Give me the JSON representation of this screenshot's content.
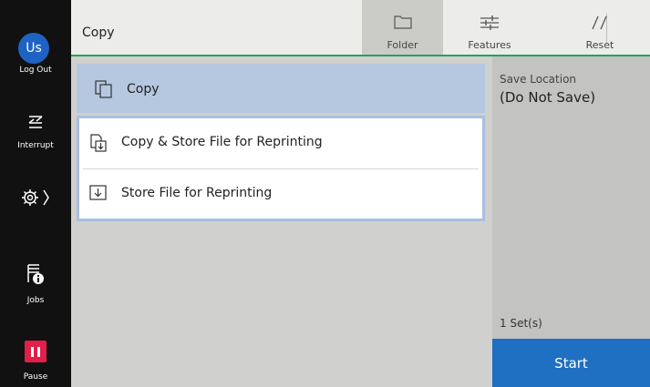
{
  "sidebar": {
    "avatar_initials": "Us",
    "logout_label": "Log Out",
    "interrupt_label": "Interrupt",
    "jobs_label": "Jobs",
    "pause_label": "Pause"
  },
  "header": {
    "title": "Copy",
    "tabs": [
      {
        "label": "Folder",
        "icon": "folder-icon"
      },
      {
        "label": "Features",
        "icon": "sliders-icon"
      },
      {
        "label": "Reset",
        "icon": "reset-icon"
      }
    ]
  },
  "list": {
    "items": [
      {
        "label": "Copy",
        "icon": "copy-icon",
        "selected": true
      },
      {
        "label": "Copy & Store File for Reprinting",
        "icon": "copy-store-icon"
      },
      {
        "label": "Store File for Reprinting",
        "icon": "store-file-icon"
      }
    ]
  },
  "right_panel": {
    "save_location_label": "Save Location",
    "save_location_value": "(Do Not Save)",
    "sets": "1 Set(s)",
    "start_label": "Start"
  },
  "colors": {
    "accent_green": "#23a35a",
    "start_blue": "#1f6fc3",
    "pause_red": "#e0204a",
    "selected_row": "#b5c8df"
  }
}
